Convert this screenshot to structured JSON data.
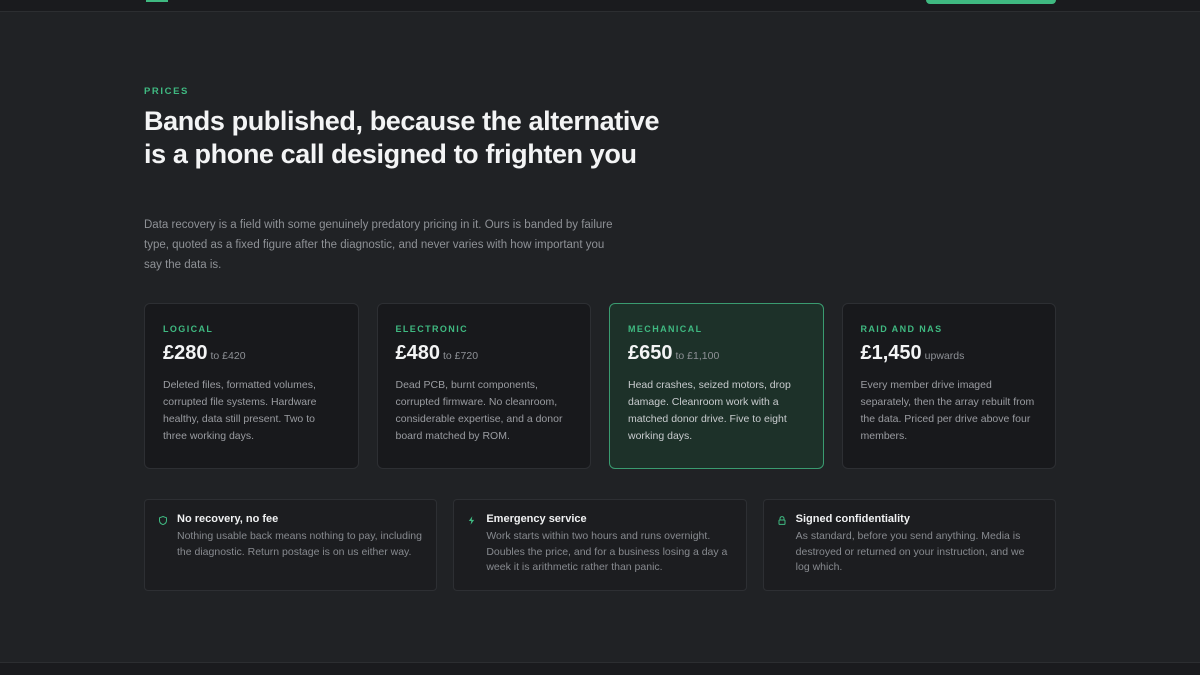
{
  "section": {
    "eyebrow": "PRICES",
    "heading": "Bands published, because the alternative is a phone call designed to frighten you",
    "intro": "Data recovery is a field with some genuinely predatory pricing in it. Ours is banded by failure type, quoted as a fixed figure after the diagnostic, and never varies with how important you say the data is."
  },
  "price_cards": [
    {
      "tag": "LOGICAL",
      "amount": "£280",
      "range": "to £420",
      "description": "Deleted files, formatted volumes, corrupted file systems. Hardware healthy, data still present. Two to three working days."
    },
    {
      "tag": "ELECTRONIC",
      "amount": "£480",
      "range": "to £720",
      "description": "Dead PCB, burnt components, corrupted firmware. No cleanroom, considerable expertise, and a donor board matched by ROM."
    },
    {
      "tag": "MECHANICAL",
      "amount": "£650",
      "range": "to £1,100",
      "description": "Head crashes, seized motors, drop damage. Cleanroom work with a matched donor drive. Five to eight working days."
    },
    {
      "tag": "RAID AND NAS",
      "amount": "£1,450",
      "range": "upwards",
      "description": "Every member drive imaged separately, then the array rebuilt from the data. Priced per drive above four members."
    }
  ],
  "features": [
    {
      "icon": "shield-icon",
      "title": "No recovery, no fee",
      "description": "Nothing usable back means nothing to pay, including the diagnostic. Return postage is on us either way."
    },
    {
      "icon": "lightning-icon",
      "title": "Emergency service",
      "description": "Work starts within two hours and runs overnight. Doubles the price, and for a business losing a day a week it is arithmetic rather than panic."
    },
    {
      "icon": "lock-icon",
      "title": "Signed confidentiality",
      "description": "As standard, before you send anything. Media is destroyed or returned on your instruction, and we log which."
    }
  ],
  "colors": {
    "background": "#202225",
    "accent": "#3fb981",
    "card": "#18191c",
    "featured_card": "#1d3129"
  }
}
